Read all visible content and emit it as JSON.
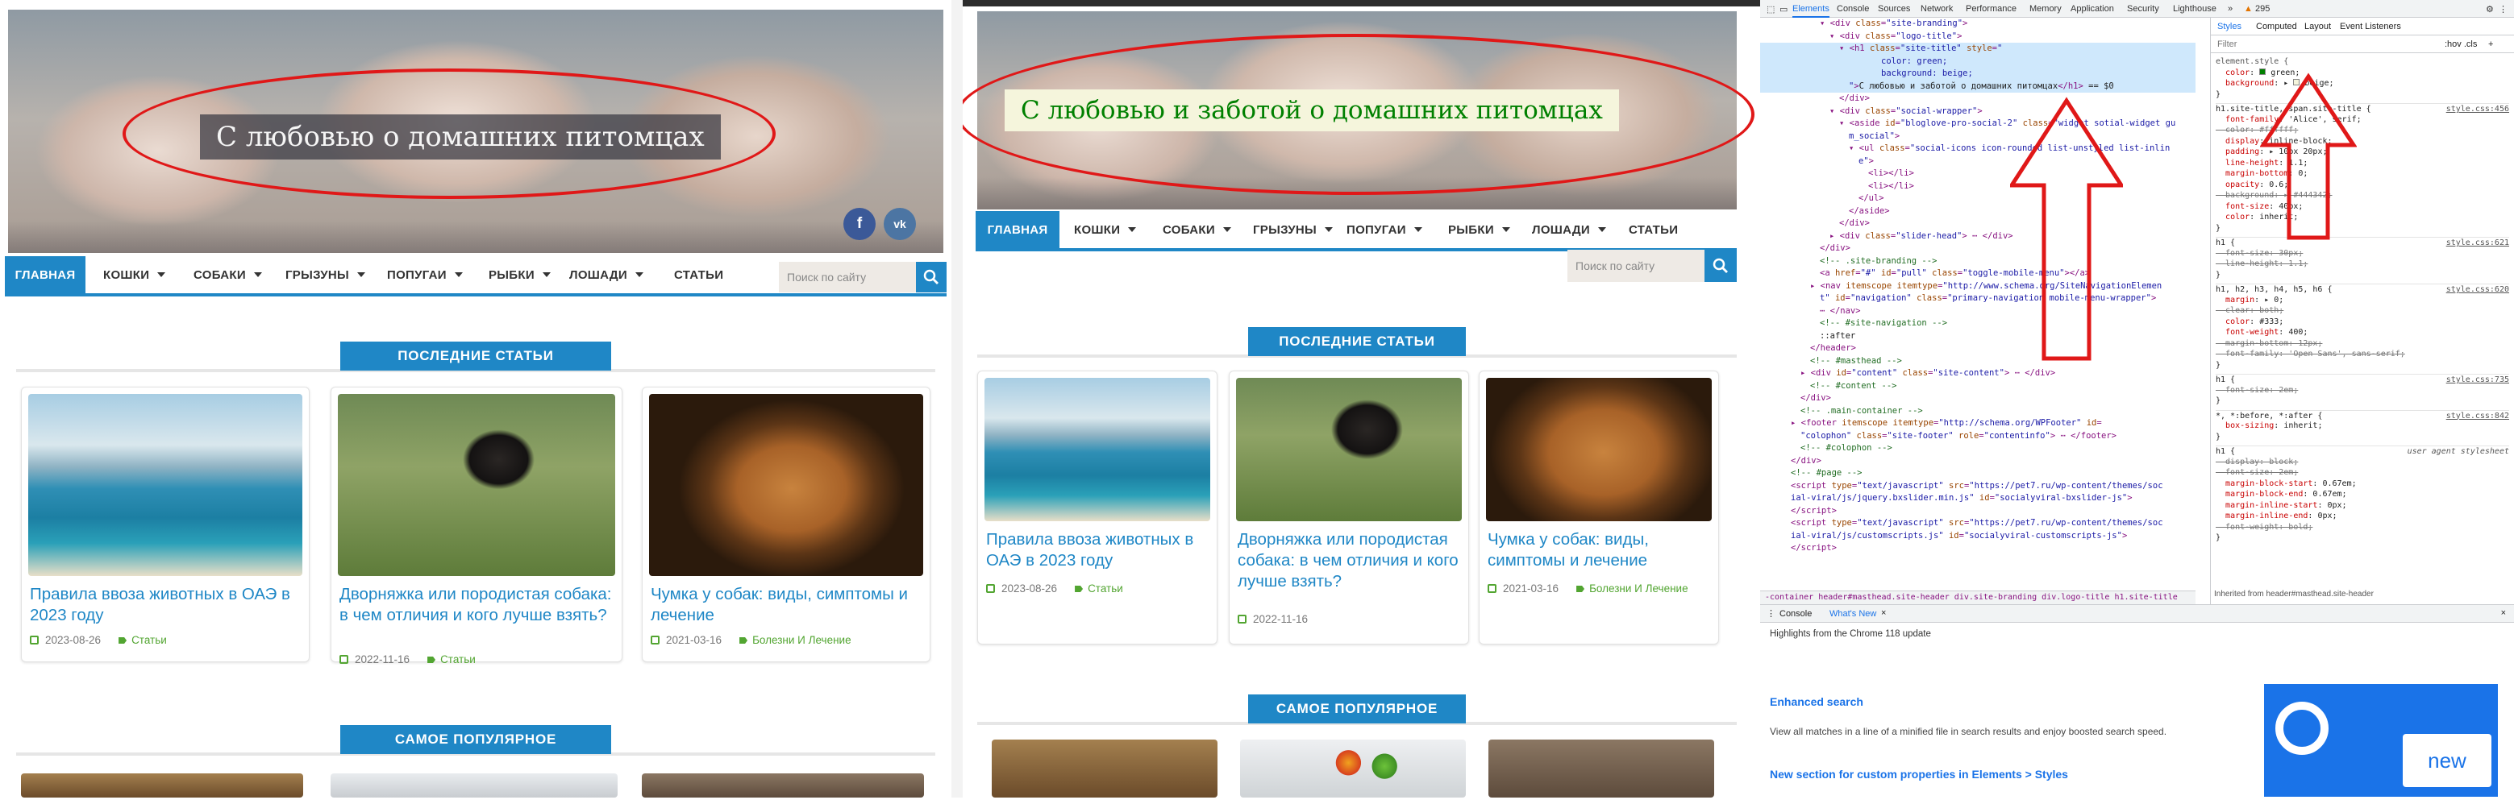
{
  "left": {
    "site_title": "С любовью о домашних питомцах",
    "nav": {
      "home": "ГЛАВНАЯ",
      "cats": "КОШКИ",
      "dogs": "СОБАКИ",
      "rodents": "ГРЫЗУНЫ",
      "parrots": "ПОПУГАИ",
      "fish": "РЫБКИ",
      "horses": "ЛОШАДИ",
      "articles": "СТАТЬИ",
      "search_placeholder": "Поиск по сайту"
    },
    "section_latest": "ПОСЛЕДНИЕ СТАТЬИ",
    "section_popular": "САМОЕ ПОПУЛЯРНОЕ",
    "cards": [
      {
        "title": "Правила ввоза животных в ОАЭ в 2023 году",
        "date": "2023-08-26",
        "category": "Статьи"
      },
      {
        "title": "Дворняжка или породистая собака: в чем отличия и кого лучше взять?",
        "date": "2022-11-16",
        "category": "Статьи"
      },
      {
        "title": "Чумка у собак: виды, симптомы и лечение",
        "date": "2021-03-16",
        "category": "Болезни И Лечение"
      }
    ]
  },
  "middle": {
    "site_title": "С любовью и заботой о домашних питомцах",
    "nav": {
      "home": "ГЛАВНАЯ",
      "cats": "КОШКИ",
      "dogs": "СОБАКИ",
      "rodents": "ГРЫЗУНЫ",
      "parrots": "ПОПУГАИ",
      "fish": "РЫБКИ",
      "horses": "ЛОШАДИ",
      "articles": "СТАТЬИ",
      "search_placeholder": "Поиск по сайту"
    },
    "section_latest": "ПОСЛЕДНИЕ СТАТЬИ",
    "section_popular": "САМОЕ ПОПУЛЯРНОЕ",
    "cards": [
      {
        "title": "Правила ввоза животных в ОАЭ в 2023 году",
        "date": "2023-08-26",
        "category": "Статьи"
      },
      {
        "title": "Дворняжка или породистая собака: в чем отличия и кого лучше взять?",
        "date": "2022-11-16",
        "category": "Статьи"
      },
      {
        "title": "Чумка у собак: виды, симптомы и лечение",
        "date": "2021-03-16",
        "category": "Болезни И Лечение"
      }
    ]
  },
  "social": {
    "fb": "f",
    "vk": "vk"
  },
  "devtools": {
    "tabs": [
      "Elements",
      "Console",
      "Sources",
      "Network",
      "Performance",
      "Memory",
      "Application",
      "Security",
      "Lighthouse"
    ],
    "badge": "295",
    "style_tabs": [
      "Styles",
      "Computed",
      "Layout",
      "Event Listeners"
    ],
    "filter_placeholder": "Filter",
    "filter_tools": ":hov .cls",
    "breadcrumb": "-container   header#masthead.site-header   div.site-branding   div.logo-title   h1.site-title",
    "inherited": "Inherited from header#masthead.site-header",
    "drawer_tabs": [
      "Console",
      "What's New"
    ],
    "drawer_note": "Highlights from the Chrome 118 update",
    "feature1_title": "Enhanced search",
    "feature1_text": "View all matches in a line of a minified file in search results and enjoy boosted search speed.",
    "feature2_title": "New section for custom properties in Elements > Styles",
    "promo": "new"
  }
}
